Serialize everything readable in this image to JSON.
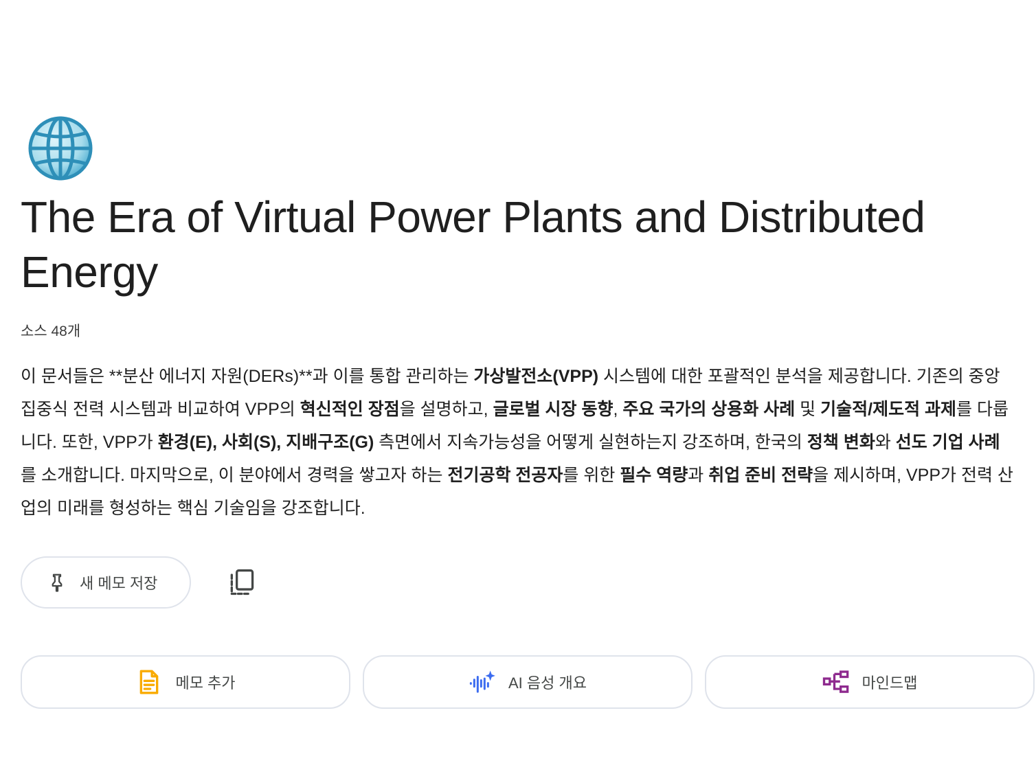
{
  "notebook": {
    "emoji": "🌐",
    "title": "The Era of Virtual Power Plants and Distributed Energy",
    "source_count": "소스 48개"
  },
  "summary": {
    "segments": [
      {
        "text": "이 문서들은 **분산 에너지 자원(DERs)**과 이를 통합 관리하는 ",
        "bold": false
      },
      {
        "text": "가상발전소(VPP)",
        "bold": true
      },
      {
        "text": " 시스템에 대한 포괄적인 분석을 제공합니다. 기존의 중앙 집중식 전력 시스템과 비교하여 VPP의 ",
        "bold": false
      },
      {
        "text": "혁신적인 장점",
        "bold": true
      },
      {
        "text": "을 설명하고, ",
        "bold": false
      },
      {
        "text": "글로벌 시장 동향",
        "bold": true
      },
      {
        "text": ", ",
        "bold": false
      },
      {
        "text": "주요 국가의 상용화 사례",
        "bold": true
      },
      {
        "text": " 및 ",
        "bold": false
      },
      {
        "text": "기술적/제도적 과제",
        "bold": true
      },
      {
        "text": "를 다룹니다. 또한, VPP가 ",
        "bold": false
      },
      {
        "text": "환경(E), 사회(S), 지배구조(G)",
        "bold": true
      },
      {
        "text": " 측면에서 지속가능성을 어떻게 실현하는지 강조하며, 한국의 ",
        "bold": false
      },
      {
        "text": "정책 변화",
        "bold": true
      },
      {
        "text": "와 ",
        "bold": false
      },
      {
        "text": "선도 기업 사례",
        "bold": true
      },
      {
        "text": "를 소개합니다. 마지막으로, 이 분야에서 경력을 쌓고자 하는 ",
        "bold": false
      },
      {
        "text": "전기공학 전공자",
        "bold": true
      },
      {
        "text": "를 위한 ",
        "bold": false
      },
      {
        "text": "필수 역량",
        "bold": true
      },
      {
        "text": "과 ",
        "bold": false
      },
      {
        "text": "취업 준비 전략",
        "bold": true
      },
      {
        "text": "을 제시하며, VPP가 전력 산업의 미래를 형성하는 핵심 기술임을 강조합니다.",
        "bold": false
      }
    ]
  },
  "actions": {
    "save_note_label": "새 메모 저장",
    "save_note_icon": "pin-icon",
    "copy_icon": "copy-icon"
  },
  "cards": [
    {
      "label": "메모 추가",
      "icon": "note-icon",
      "color": "#f9ab00"
    },
    {
      "label": "AI 음성 개요",
      "icon": "audio-overview-icon",
      "color": "#3c6cf0"
    },
    {
      "label": "마인드맵",
      "icon": "mindmap-icon",
      "color": "#8e2a8e"
    }
  ]
}
